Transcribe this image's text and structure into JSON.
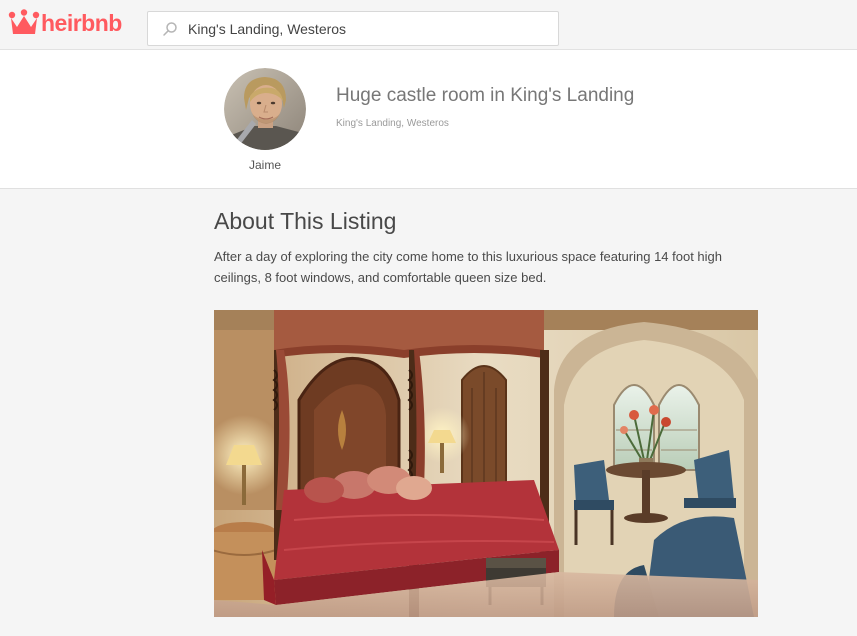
{
  "brand": {
    "name": "heirbnb",
    "color": "#ff5a5f",
    "logo_icon": "crown-icon"
  },
  "search": {
    "value": "King's Landing, Westeros",
    "icon": "search-icon"
  },
  "host": {
    "name": "Jaime",
    "avatar": "host-avatar-photo"
  },
  "listing": {
    "title": "Huge castle room in King's Landing",
    "location": "King's Landing, Westeros"
  },
  "about": {
    "heading": "About This Listing",
    "description": "After a day of exploring the city come home to this luxurious space featuring 14 foot high ceilings, 8 foot windows, and comfortable queen size bed."
  },
  "photo": {
    "subject": "castle-bedroom-photo"
  }
}
